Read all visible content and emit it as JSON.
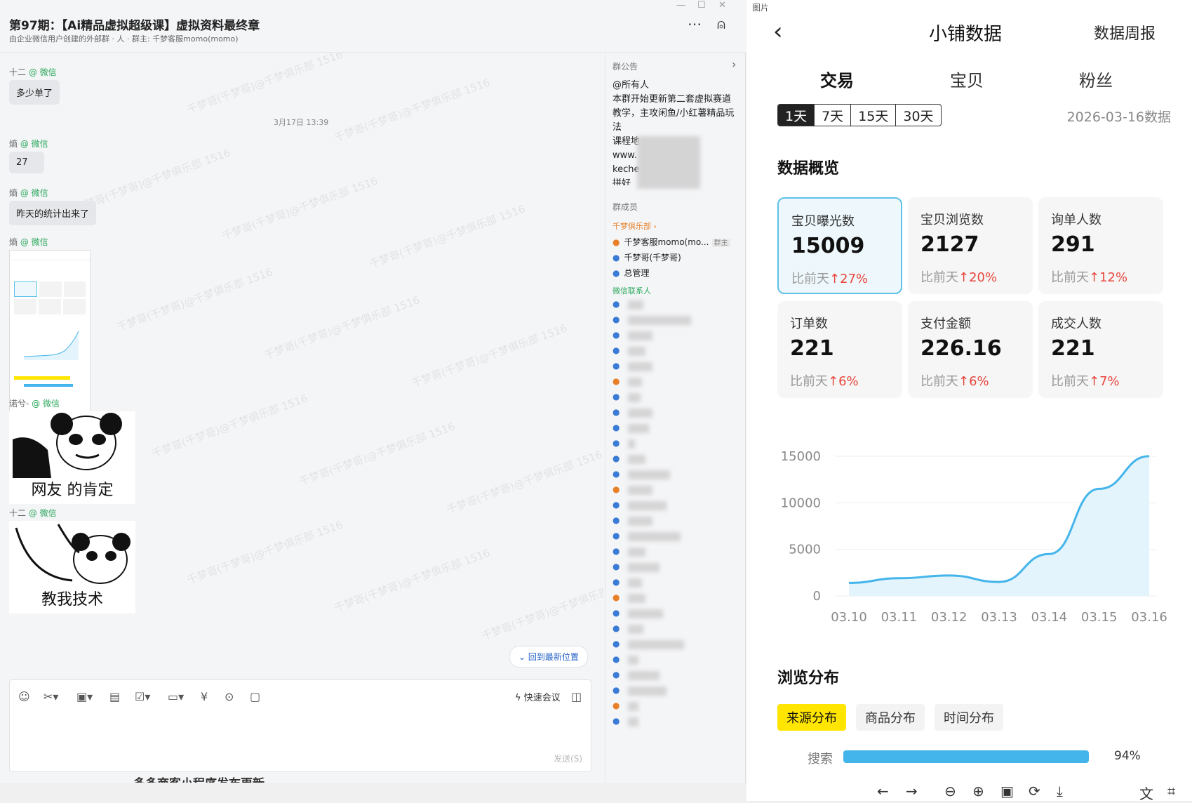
{
  "left": {
    "title": "第97期：【Ai精品虚拟超级课】虚拟资料最终章",
    "subtitle": "由企业微信用户创建的外部群 · 人 · 群主: 千梦客服momo(momo)",
    "watermark": "千梦哥(千梦哥)@千梦俱乐部 1516",
    "messages": [
      {
        "sender": "十二",
        "via": "@ 微信",
        "text": "多少单了"
      },
      {
        "sender": "熵",
        "via": "@ 微信",
        "text": "27"
      },
      {
        "sender": "熵",
        "via": "@ 微信",
        "text": "昨天的统计出来了"
      },
      {
        "sender": "熵",
        "via": "@ 微信"
      },
      {
        "sender": "诺兮-",
        "via": "@ 微信",
        "caption": "网友 的肯定"
      },
      {
        "sender": "十二",
        "via": "@ 微信",
        "caption": "教我技术"
      }
    ],
    "timestamp": "3月17日 13:39",
    "jump_latest": "回到最新位置",
    "quick_meeting": "快速会议",
    "send": "发送(S)",
    "bottom_snippet": "多多商客小程序发布更新"
  },
  "side": {
    "notice_label": "群公告",
    "notice_lines": [
      "@所有人",
      "本群开始更新第二套虚拟赛道教学，主攻闲鱼/小红薯精品玩法",
      "课程地",
      "www.",
      "keche",
      "拼好"
    ],
    "members_label": "群成员",
    "group1": "千梦俱乐部 ›",
    "members": [
      {
        "name": "千梦客服momo(mo...",
        "badge": "群主"
      },
      {
        "name": "千梦哥(千梦哥)"
      },
      {
        "name": "总管理"
      }
    ],
    "group2": "微信联系人"
  },
  "viewer": {
    "tag": "图片",
    "title": "小铺数据",
    "weekly": "数据周报",
    "tabs": [
      "交易",
      "宝贝",
      "粉丝"
    ],
    "periods": [
      "1天",
      "7天",
      "15天",
      "30天"
    ],
    "date": "2026-03-16数据",
    "overview": "数据概览",
    "cards": [
      {
        "title": "宝贝曝光数",
        "value": "15009",
        "prefix": "比前天",
        "change": "↑27%"
      },
      {
        "title": "宝贝浏览数",
        "value": "2127",
        "prefix": "比前天",
        "change": "↑20%"
      },
      {
        "title": "询单人数",
        "value": "291",
        "prefix": "比前天",
        "change": "↑12%"
      },
      {
        "title": "订单数",
        "value": "221",
        "prefix": "比前天",
        "change": "↑6%"
      },
      {
        "title": "支付金额",
        "value": "226.16",
        "prefix": "比前天",
        "change": "↑6%"
      },
      {
        "title": "成交人数",
        "value": "221",
        "prefix": "比前天",
        "change": "↑7%"
      }
    ],
    "browse": "浏览分布",
    "pills": [
      "来源分布",
      "商品分布",
      "时间分布"
    ],
    "bar": {
      "label": "搜索",
      "value_text": "94%",
      "value": 0.94
    }
  },
  "chart_data": {
    "type": "area",
    "x": [
      "03.10",
      "03.11",
      "03.12",
      "03.13",
      "03.14",
      "03.15",
      "03.16"
    ],
    "series": [
      {
        "values": [
          1400,
          1900,
          2200,
          1500,
          4500,
          11500,
          15009
        ]
      }
    ],
    "yticks": [
      0,
      5000,
      10000,
      15000
    ],
    "ylim": [
      0,
      15000
    ],
    "grid": true,
    "colors": {
      "line": "#44b5ea",
      "fill": "#e4f4fd"
    }
  }
}
